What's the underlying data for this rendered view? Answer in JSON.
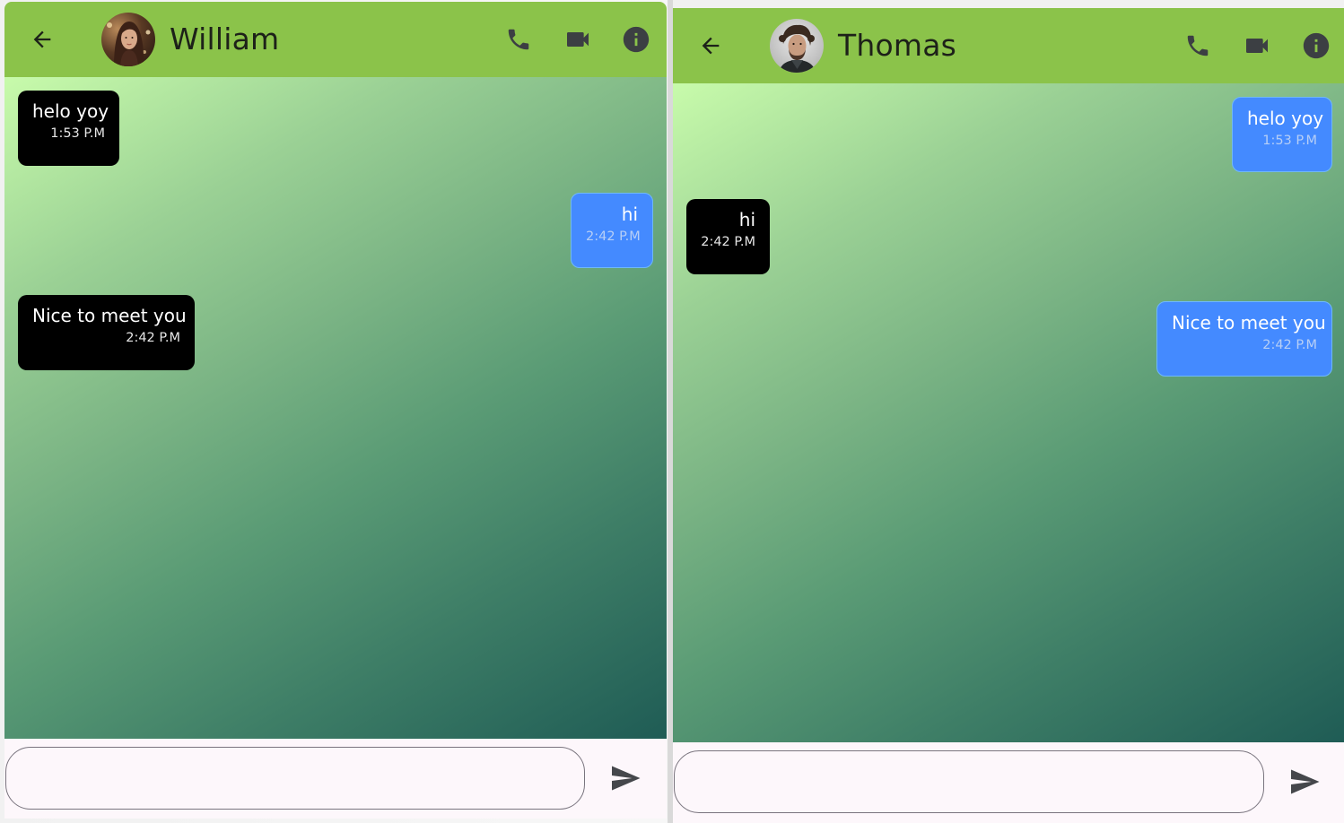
{
  "colors": {
    "app_bar": "#8bc34a",
    "incoming_bubble": "#000000",
    "outgoing_bubble": "#448aff",
    "input_background": "#fdf7fb"
  },
  "icons": {
    "back": "arrow-back-icon",
    "call": "phone-icon",
    "video": "videocam-icon",
    "info": "info-icon",
    "send": "send-icon"
  },
  "left_chat": {
    "contact_name": "William",
    "messages": [
      {
        "text": "helo yoy",
        "time": "1:53 P.M",
        "direction": "incoming"
      },
      {
        "text": "hi",
        "time": "2:42 P.M",
        "direction": "outgoing"
      },
      {
        "text": "Nice to meet you",
        "time": "2:42 P.M",
        "direction": "incoming"
      }
    ],
    "input": {
      "value": "",
      "placeholder": ""
    }
  },
  "right_chat": {
    "contact_name": "Thomas",
    "messages": [
      {
        "text": "helo yoy",
        "time": "1:53 P.M",
        "direction": "outgoing"
      },
      {
        "text": "hi",
        "time": "2:42 P.M",
        "direction": "incoming"
      },
      {
        "text": "Nice to meet you",
        "time": "2:42 P.M",
        "direction": "outgoing"
      }
    ],
    "input": {
      "value": "",
      "placeholder": ""
    }
  }
}
